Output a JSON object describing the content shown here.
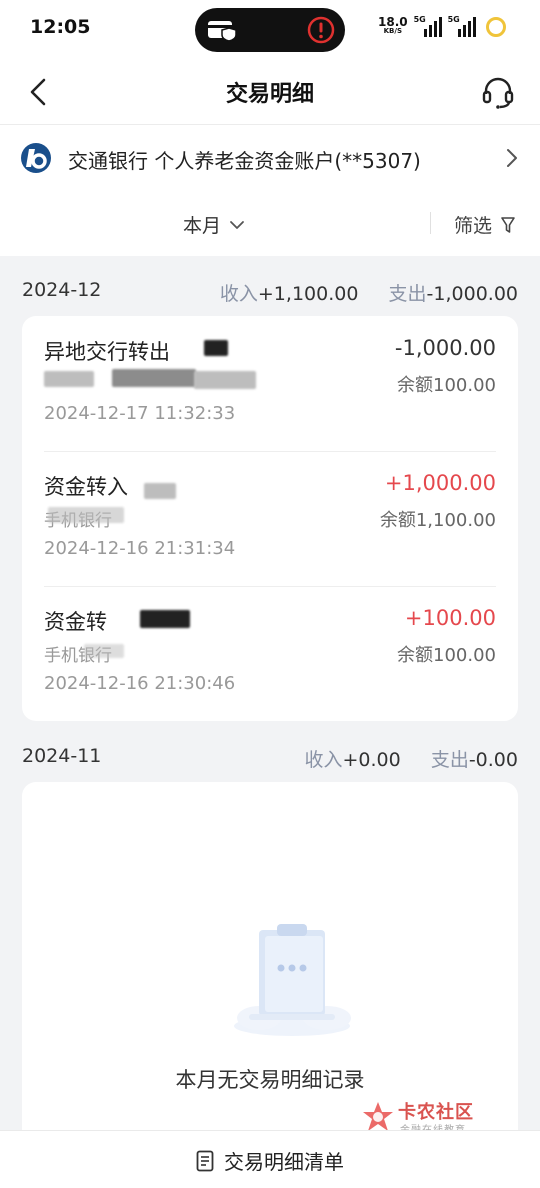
{
  "status_bar": {
    "time": "12:05",
    "net_speed": "18.0",
    "net_unit": "KB/S",
    "signal1_label": "5G",
    "signal2_label": "5G"
  },
  "nav": {
    "title": "交易明细",
    "back_icon": "chevron-left-icon",
    "support_icon": "headset-icon"
  },
  "account": {
    "text": "交通银行 个人养老金资金账户(**5307)",
    "logo_icon": "bank-logo-icon"
  },
  "filter": {
    "month_label": "本月",
    "filter_label": "筛选"
  },
  "months": [
    {
      "label": "2024-12",
      "income_key": "收入",
      "income_value": "+1,100.00",
      "expense_key": "支出",
      "expense_value": "-1,000.00",
      "transactions": [
        {
          "title": "异地交行转出",
          "channel": "",
          "time": "2024-12-17 11:32:33",
          "amount": "-1,000.00",
          "balance": "余额100.00"
        },
        {
          "title": "资金转入",
          "channel": "手机银行",
          "time": "2024-12-16 21:31:34",
          "amount": "+1,000.00",
          "balance": "余额1,100.00"
        },
        {
          "title": "资金转",
          "channel": "手机银行",
          "time": "2024-12-16 21:30:46",
          "amount": "+100.00",
          "balance": "余额100.00"
        }
      ]
    },
    {
      "label": "2024-11",
      "income_key": "收入",
      "income_value": "+0.00",
      "expense_key": "支出",
      "expense_value": "-0.00",
      "empty_text": "本月无交易明细记录"
    }
  ],
  "watermark": {
    "title": "卡农社区",
    "subtitle": "金融在线教育"
  },
  "bottom": {
    "label": "交易明细清单"
  },
  "colors": {
    "income_positive": "#e5484d",
    "muted_key": "#8a93a6",
    "background": "#f2f3f5"
  }
}
